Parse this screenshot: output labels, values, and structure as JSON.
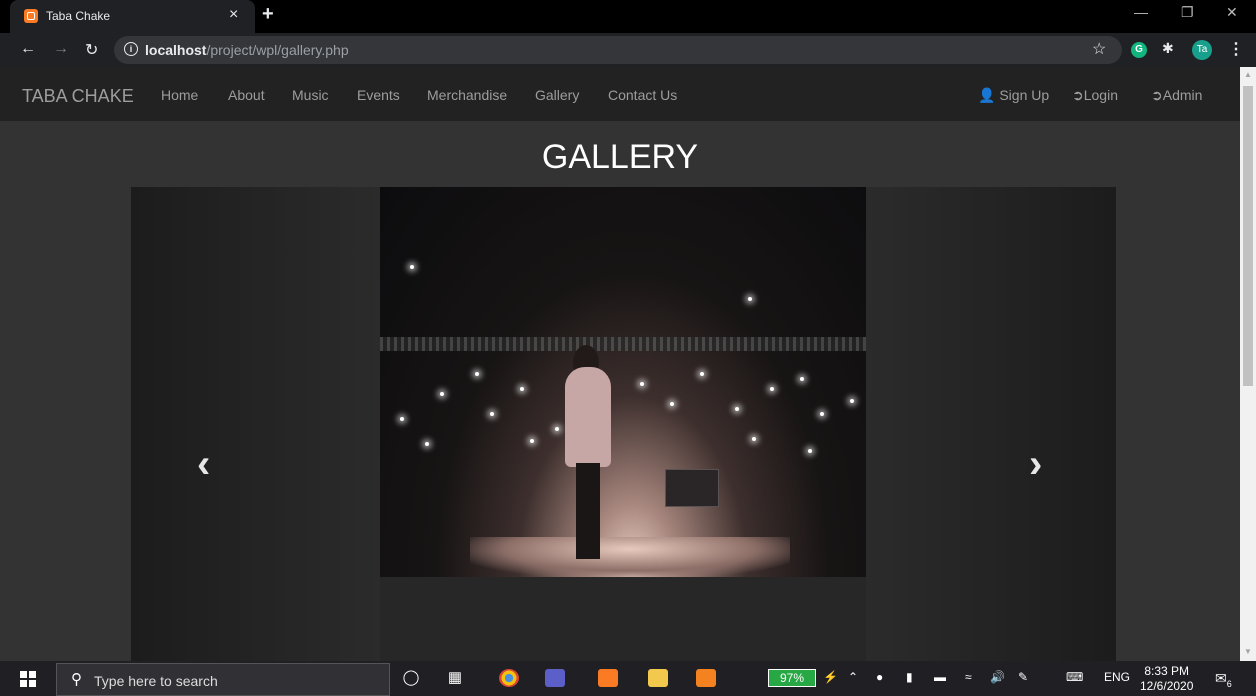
{
  "browser": {
    "tab_title": "Taba Chake",
    "tab_close": "×",
    "new_tab": "+",
    "url_host": "localhost",
    "url_path": "/project/wpl/gallery.php",
    "profile_initials": "Ta",
    "ext_letter": "G"
  },
  "site": {
    "brand": "TABA CHAKE",
    "nav": [
      "Home",
      "About",
      "Music",
      "Events",
      "Merchandise",
      "Gallery",
      "Contact Us"
    ],
    "nav_right": {
      "signup": "Sign Up",
      "login": "Login",
      "admin": "Admin"
    }
  },
  "page": {
    "title": "GALLERY",
    "prev": "‹",
    "next": "›"
  },
  "taskbar": {
    "search_placeholder": "Type here to search",
    "battery": "97%",
    "language": "ENG",
    "time": "8:33 PM",
    "date": "12/6/2020",
    "notification_count": "6"
  },
  "colors": {
    "navbar": "#222222",
    "page_bg": "#333333",
    "link": "#9d9d9d",
    "battery": "#27a844"
  }
}
